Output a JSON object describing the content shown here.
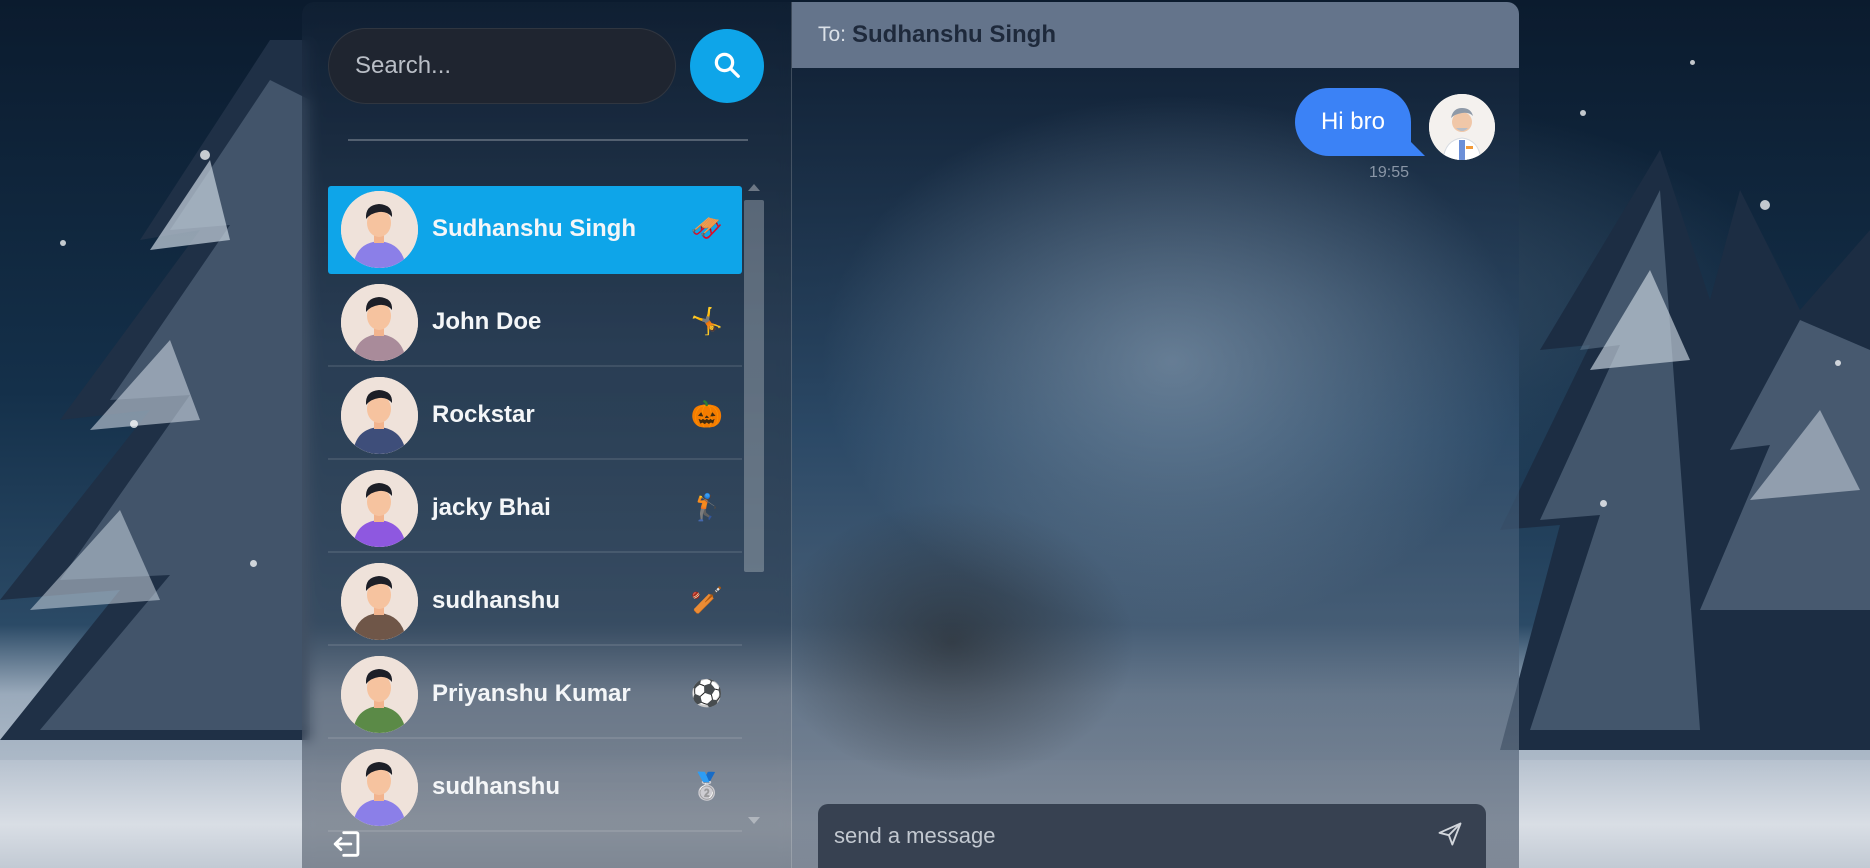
{
  "search": {
    "placeholder": "Search..."
  },
  "contacts": [
    {
      "name": "Sudhanshu Singh",
      "emoji": "🛷",
      "active": true,
      "shirt": "#8b7fe8"
    },
    {
      "name": "John Doe",
      "emoji": "🤸",
      "active": false,
      "shirt": "#a98b9a"
    },
    {
      "name": "Rockstar",
      "emoji": "🎃",
      "active": false,
      "shirt": "#3e4e7a"
    },
    {
      "name": "jacky Bhai",
      "emoji": "🏌",
      "active": false,
      "shirt": "#8e58e0"
    },
    {
      "name": "sudhanshu",
      "emoji": "🏏",
      "active": false,
      "shirt": "#6f5648"
    },
    {
      "name": "Priyanshu Kumar",
      "emoji": "⚽",
      "active": false,
      "shirt": "#5b8a47"
    },
    {
      "name": "sudhanshu",
      "emoji": "🥈",
      "active": false,
      "shirt": "#8b7fe8"
    }
  ],
  "chat": {
    "to_label": "To:",
    "to_name": "Sudhanshu Singh",
    "messages": [
      {
        "text": "Hi bro",
        "time": "19:55",
        "from_me": true
      }
    ],
    "composer_placeholder": "send a message"
  },
  "colors": {
    "accent": "#0ea5e9",
    "bubble": "#3b82f6",
    "header": "#64748b",
    "composer": "#374151"
  }
}
